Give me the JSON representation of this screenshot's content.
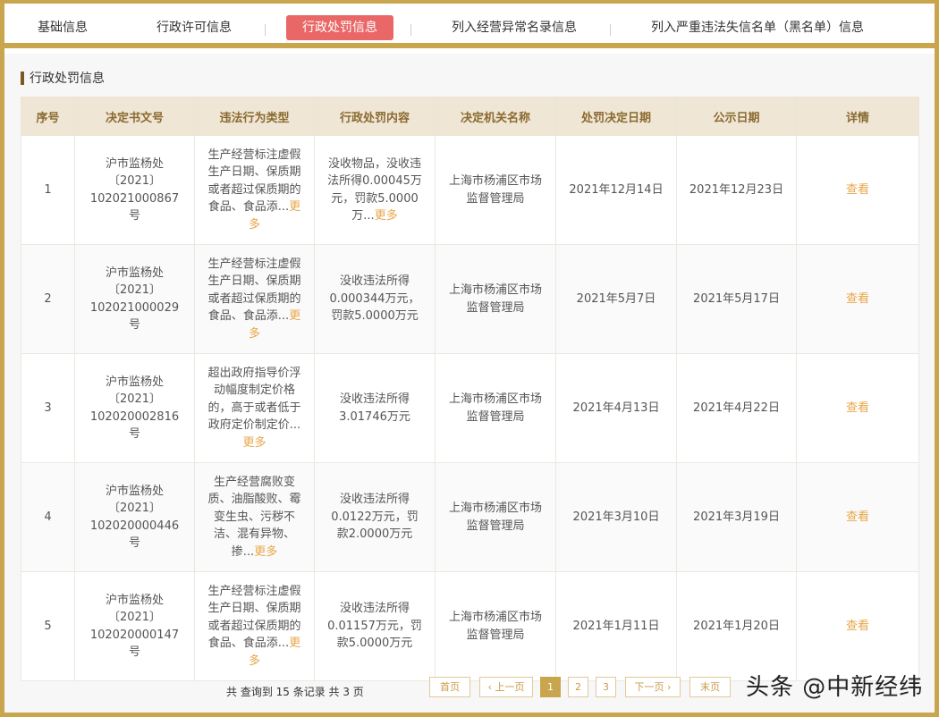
{
  "tabs": [
    {
      "label": "基础信息",
      "active": false
    },
    {
      "label": "行政许可信息",
      "active": false
    },
    {
      "label": "行政处罚信息",
      "active": true
    },
    {
      "label": "列入经营异常名录信息",
      "active": false
    },
    {
      "label": "列入严重违法失信名单（黑名单）信息",
      "active": false
    }
  ],
  "section": {
    "title": "行政处罚信息"
  },
  "table": {
    "headers": [
      "序号",
      "决定书文号",
      "违法行为类型",
      "行政处罚内容",
      "决定机关名称",
      "处罚决定日期",
      "公示日期",
      "详情"
    ],
    "more_label": "更多",
    "view_label": "查看",
    "rows": [
      {
        "index": "1",
        "doc_no": "沪市监杨处〔2021〕102021000867号",
        "type_text": "生产经营标注虚假生产日期、保质期或者超过保质期的食品、食品添...",
        "content_text": "没收物品，没收违法所得0.00045万元，罚款5.0000万...",
        "authority": "上海市杨浦区市场监督管理局",
        "decision_date": "2021年12月14日",
        "publish_date": "2021年12月23日"
      },
      {
        "index": "2",
        "doc_no": "沪市监杨处〔2021〕102021000029号",
        "type_text": "生产经营标注虚假生产日期、保质期或者超过保质期的食品、食品添...",
        "content_text": "没收违法所得0.000344万元，罚款5.0000万元",
        "authority": "上海市杨浦区市场监督管理局",
        "decision_date": "2021年5月7日",
        "publish_date": "2021年5月17日"
      },
      {
        "index": "3",
        "doc_no": "沪市监杨处〔2021〕102020002816号",
        "type_text": "超出政府指导价浮动幅度制定价格的，高于或者低于政府定价制定价...",
        "content_text": "没收违法所得3.01746万元",
        "authority": "上海市杨浦区市场监督管理局",
        "decision_date": "2021年4月13日",
        "publish_date": "2021年4月22日"
      },
      {
        "index": "4",
        "doc_no": "沪市监杨处〔2021〕102020000446号",
        "type_text": "生产经营腐败变质、油脂酸败、霉变生虫、污秽不洁、混有异物、掺...",
        "content_text": "没收违法所得0.0122万元，罚款2.0000万元",
        "authority": "上海市杨浦区市场监督管理局",
        "decision_date": "2021年3月10日",
        "publish_date": "2021年3月19日"
      },
      {
        "index": "5",
        "doc_no": "沪市监杨处〔2021〕102020000147号",
        "type_text": "生产经营标注虚假生产日期、保质期或者超过保质期的食品、食品添...",
        "content_text": "没收违法所得0.01157万元，罚款5.0000万元",
        "authority": "上海市杨浦区市场监督管理局",
        "decision_date": "2021年1月11日",
        "publish_date": "2021年1月20日"
      }
    ]
  },
  "pagination": {
    "summary": "共 查询到 15 条记录 共 3 页",
    "first": "首页",
    "prev": "上一页",
    "pages": [
      "1",
      "2",
      "3"
    ],
    "current_page": "1",
    "next": "下一页",
    "last": "末页",
    "prev_icon": "chevron-left-icon",
    "next_icon": "chevron-right-icon"
  },
  "watermark": "头条 @中新经纬",
  "colors": {
    "accent": "#c9a64d",
    "active_tab": "#ea6767",
    "link": "#e8a648",
    "header_bg": "#efe6d5"
  }
}
